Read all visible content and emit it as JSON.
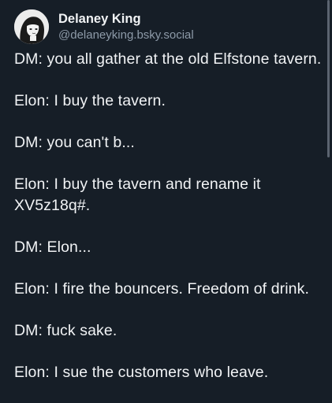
{
  "author": {
    "display_name": "Delaney King",
    "handle": "@delaneyking.bsky.social"
  },
  "post": {
    "paragraphs": [
      "DM: you all gather at the old Elfstone tavern.",
      "Elon: I buy the tavern.",
      "DM: you can't b...",
      "Elon: I buy the tavern and rename it XV5z18q#.",
      "DM: Elon...",
      "Elon: I fire the bouncers.  Freedom of drink.",
      "DM: fuck sake.",
      "Elon: I sue the customers who leave."
    ]
  },
  "colors": {
    "background": "#161e27",
    "text": "#f1f3f5",
    "handle": "#8d9aa8"
  },
  "icons": {
    "avatar": "profile-avatar-illustration"
  }
}
